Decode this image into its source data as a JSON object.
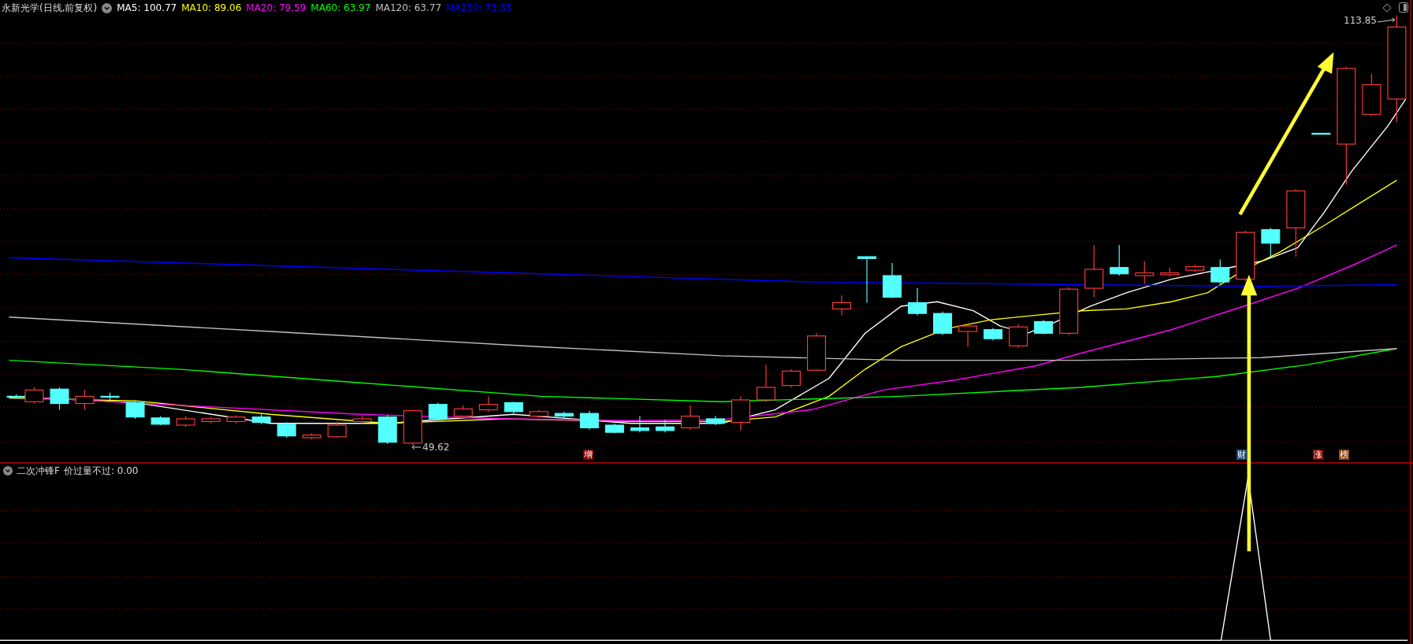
{
  "header": {
    "title": "永新光学(日线,前复权)",
    "indicators": [
      {
        "label": "MA5: 100.77",
        "color": "#ffffff"
      },
      {
        "label": "MA10: 89.06",
        "color": "#ffff00"
      },
      {
        "label": "MA20: 79.59",
        "color": "#ff00ff"
      },
      {
        "label": "MA60: 63.97",
        "color": "#00ff00"
      },
      {
        "label": "MA120: 63.77",
        "color": "#c0c0c0"
      },
      {
        "label": "MA250: 73.55",
        "color": "#0000ff"
      }
    ]
  },
  "price_labels": {
    "high": "113.85",
    "low": "49.62"
  },
  "markers": [
    {
      "label": "增",
      "color": "#8b0000"
    },
    {
      "label": "财",
      "color": "#1e4b7a"
    },
    {
      "label": "涨",
      "color": "#8b0000"
    },
    {
      "label": "榜",
      "color": "#8b4513"
    }
  ],
  "sub_pane": {
    "title": "二次冲锋F",
    "reading": "价过量不过: 0.00"
  }
}
